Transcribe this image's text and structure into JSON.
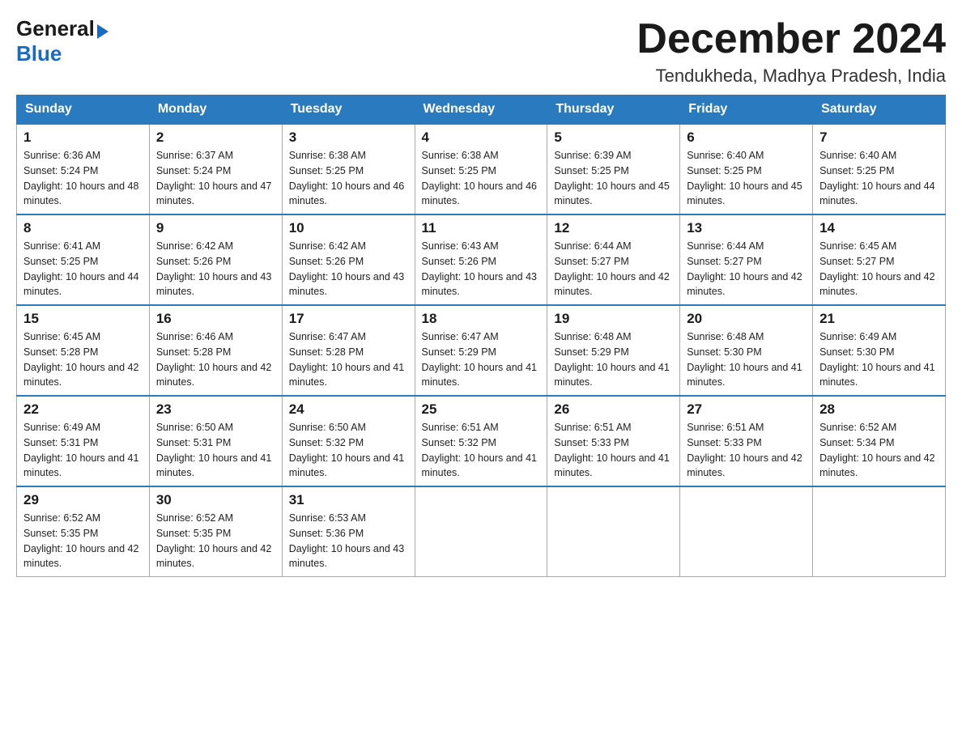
{
  "header": {
    "logo_general": "General",
    "logo_blue": "Blue",
    "month_title": "December 2024",
    "location": "Tendukheda, Madhya Pradesh, India"
  },
  "days_of_week": [
    "Sunday",
    "Monday",
    "Tuesday",
    "Wednesday",
    "Thursday",
    "Friday",
    "Saturday"
  ],
  "weeks": [
    [
      {
        "day": "1",
        "sunrise": "Sunrise: 6:36 AM",
        "sunset": "Sunset: 5:24 PM",
        "daylight": "Daylight: 10 hours and 48 minutes."
      },
      {
        "day": "2",
        "sunrise": "Sunrise: 6:37 AM",
        "sunset": "Sunset: 5:24 PM",
        "daylight": "Daylight: 10 hours and 47 minutes."
      },
      {
        "day": "3",
        "sunrise": "Sunrise: 6:38 AM",
        "sunset": "Sunset: 5:25 PM",
        "daylight": "Daylight: 10 hours and 46 minutes."
      },
      {
        "day": "4",
        "sunrise": "Sunrise: 6:38 AM",
        "sunset": "Sunset: 5:25 PM",
        "daylight": "Daylight: 10 hours and 46 minutes."
      },
      {
        "day": "5",
        "sunrise": "Sunrise: 6:39 AM",
        "sunset": "Sunset: 5:25 PM",
        "daylight": "Daylight: 10 hours and 45 minutes."
      },
      {
        "day": "6",
        "sunrise": "Sunrise: 6:40 AM",
        "sunset": "Sunset: 5:25 PM",
        "daylight": "Daylight: 10 hours and 45 minutes."
      },
      {
        "day": "7",
        "sunrise": "Sunrise: 6:40 AM",
        "sunset": "Sunset: 5:25 PM",
        "daylight": "Daylight: 10 hours and 44 minutes."
      }
    ],
    [
      {
        "day": "8",
        "sunrise": "Sunrise: 6:41 AM",
        "sunset": "Sunset: 5:25 PM",
        "daylight": "Daylight: 10 hours and 44 minutes."
      },
      {
        "day": "9",
        "sunrise": "Sunrise: 6:42 AM",
        "sunset": "Sunset: 5:26 PM",
        "daylight": "Daylight: 10 hours and 43 minutes."
      },
      {
        "day": "10",
        "sunrise": "Sunrise: 6:42 AM",
        "sunset": "Sunset: 5:26 PM",
        "daylight": "Daylight: 10 hours and 43 minutes."
      },
      {
        "day": "11",
        "sunrise": "Sunrise: 6:43 AM",
        "sunset": "Sunset: 5:26 PM",
        "daylight": "Daylight: 10 hours and 43 minutes."
      },
      {
        "day": "12",
        "sunrise": "Sunrise: 6:44 AM",
        "sunset": "Sunset: 5:27 PM",
        "daylight": "Daylight: 10 hours and 42 minutes."
      },
      {
        "day": "13",
        "sunrise": "Sunrise: 6:44 AM",
        "sunset": "Sunset: 5:27 PM",
        "daylight": "Daylight: 10 hours and 42 minutes."
      },
      {
        "day": "14",
        "sunrise": "Sunrise: 6:45 AM",
        "sunset": "Sunset: 5:27 PM",
        "daylight": "Daylight: 10 hours and 42 minutes."
      }
    ],
    [
      {
        "day": "15",
        "sunrise": "Sunrise: 6:45 AM",
        "sunset": "Sunset: 5:28 PM",
        "daylight": "Daylight: 10 hours and 42 minutes."
      },
      {
        "day": "16",
        "sunrise": "Sunrise: 6:46 AM",
        "sunset": "Sunset: 5:28 PM",
        "daylight": "Daylight: 10 hours and 42 minutes."
      },
      {
        "day": "17",
        "sunrise": "Sunrise: 6:47 AM",
        "sunset": "Sunset: 5:28 PM",
        "daylight": "Daylight: 10 hours and 41 minutes."
      },
      {
        "day": "18",
        "sunrise": "Sunrise: 6:47 AM",
        "sunset": "Sunset: 5:29 PM",
        "daylight": "Daylight: 10 hours and 41 minutes."
      },
      {
        "day": "19",
        "sunrise": "Sunrise: 6:48 AM",
        "sunset": "Sunset: 5:29 PM",
        "daylight": "Daylight: 10 hours and 41 minutes."
      },
      {
        "day": "20",
        "sunrise": "Sunrise: 6:48 AM",
        "sunset": "Sunset: 5:30 PM",
        "daylight": "Daylight: 10 hours and 41 minutes."
      },
      {
        "day": "21",
        "sunrise": "Sunrise: 6:49 AM",
        "sunset": "Sunset: 5:30 PM",
        "daylight": "Daylight: 10 hours and 41 minutes."
      }
    ],
    [
      {
        "day": "22",
        "sunrise": "Sunrise: 6:49 AM",
        "sunset": "Sunset: 5:31 PM",
        "daylight": "Daylight: 10 hours and 41 minutes."
      },
      {
        "day": "23",
        "sunrise": "Sunrise: 6:50 AM",
        "sunset": "Sunset: 5:31 PM",
        "daylight": "Daylight: 10 hours and 41 minutes."
      },
      {
        "day": "24",
        "sunrise": "Sunrise: 6:50 AM",
        "sunset": "Sunset: 5:32 PM",
        "daylight": "Daylight: 10 hours and 41 minutes."
      },
      {
        "day": "25",
        "sunrise": "Sunrise: 6:51 AM",
        "sunset": "Sunset: 5:32 PM",
        "daylight": "Daylight: 10 hours and 41 minutes."
      },
      {
        "day": "26",
        "sunrise": "Sunrise: 6:51 AM",
        "sunset": "Sunset: 5:33 PM",
        "daylight": "Daylight: 10 hours and 41 minutes."
      },
      {
        "day": "27",
        "sunrise": "Sunrise: 6:51 AM",
        "sunset": "Sunset: 5:33 PM",
        "daylight": "Daylight: 10 hours and 42 minutes."
      },
      {
        "day": "28",
        "sunrise": "Sunrise: 6:52 AM",
        "sunset": "Sunset: 5:34 PM",
        "daylight": "Daylight: 10 hours and 42 minutes."
      }
    ],
    [
      {
        "day": "29",
        "sunrise": "Sunrise: 6:52 AM",
        "sunset": "Sunset: 5:35 PM",
        "daylight": "Daylight: 10 hours and 42 minutes."
      },
      {
        "day": "30",
        "sunrise": "Sunrise: 6:52 AM",
        "sunset": "Sunset: 5:35 PM",
        "daylight": "Daylight: 10 hours and 42 minutes."
      },
      {
        "day": "31",
        "sunrise": "Sunrise: 6:53 AM",
        "sunset": "Sunset: 5:36 PM",
        "daylight": "Daylight: 10 hours and 43 minutes."
      },
      null,
      null,
      null,
      null
    ]
  ]
}
